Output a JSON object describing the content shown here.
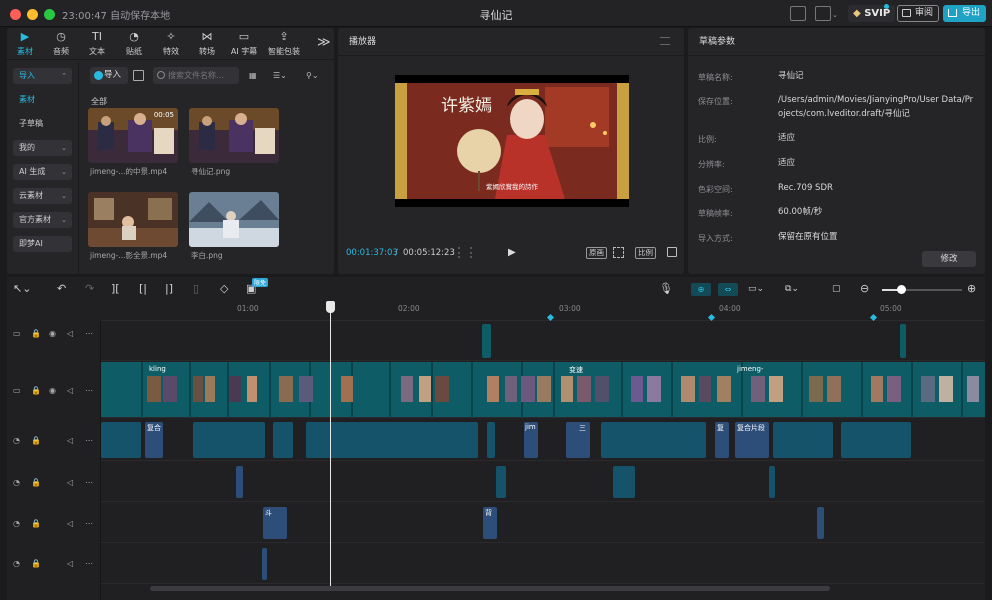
{
  "window": {
    "status": "23:00:47 自动保存本地",
    "title": "寻仙记",
    "svip": "SVIP",
    "review_label": "审阅",
    "export_label": "导出"
  },
  "media": {
    "tabs": [
      {
        "label": "素材",
        "icon": "media-icon",
        "glyph": "▶",
        "active": true
      },
      {
        "label": "音频",
        "icon": "audio-icon",
        "glyph": "◷"
      },
      {
        "label": "文本",
        "icon": "text-icon",
        "glyph": "TI"
      },
      {
        "label": "贴纸",
        "icon": "sticker-icon",
        "glyph": "◔"
      },
      {
        "label": "特效",
        "icon": "effects-icon",
        "glyph": "✧"
      },
      {
        "label": "转场",
        "icon": "transition-icon",
        "glyph": "⋈"
      },
      {
        "label": "AI 字幕",
        "icon": "ai-caption-icon",
        "glyph": "▭"
      },
      {
        "label": "智能包装",
        "icon": "smart-pack-icon",
        "glyph": "⇪"
      }
    ],
    "more_tabs": "≫",
    "nav": [
      {
        "label": "导入",
        "active": true,
        "boxed": true,
        "chev": "⌃"
      },
      {
        "label": "素材",
        "active": true
      },
      {
        "label": "子草稿"
      },
      {
        "label": "我的",
        "boxed": true,
        "chev": "⌄"
      },
      {
        "label": "AI 生成",
        "boxed": true,
        "chev": "⌄"
      },
      {
        "label": "云素材",
        "boxed": true,
        "chev": "⌄"
      },
      {
        "label": "官方素材",
        "boxed": true,
        "chev": "⌄"
      },
      {
        "label": "即梦AI",
        "boxed": true
      }
    ],
    "import_label": "导入",
    "search_placeholder": "搜索文件名称...",
    "section_label": "全部",
    "items": [
      {
        "caption": "jimeng-...的中景.mp4",
        "duration": "00:05"
      },
      {
        "caption": "寻仙记.png"
      },
      {
        "caption": "jimeng-...影全景.mp4"
      },
      {
        "caption": "李白.png"
      }
    ]
  },
  "player": {
    "title": "播放器",
    "video_title": "许紫嫣",
    "subtitle": "紫嫣欣賞我的詩作",
    "current_time": "00:01:37:03",
    "separator": "/",
    "total_time": "00:05:12:23",
    "original_label": "原画",
    "ratio_label": "比例"
  },
  "props": {
    "title": "草稿参数",
    "rows": [
      {
        "label": "草稿名称:",
        "value": "寻仙记"
      },
      {
        "label": "保存位置:",
        "value": "/Users/admin/Movies/JianyingPro/User Data/Projects/com.lveditor.draft/寻仙记"
      },
      {
        "label": "比例:",
        "value": "适应"
      },
      {
        "label": "分辨率:",
        "value": "适应"
      },
      {
        "label": "色彩空间:",
        "value": "Rec.709 SDR"
      },
      {
        "label": "草稿帧率:",
        "value": "60.00帧/秒"
      },
      {
        "label": "导入方式:",
        "value": "保留在原有位置"
      }
    ],
    "modify_label": "修改"
  },
  "timeline": {
    "limited_badge": "限免",
    "ruler": [
      "01:00",
      "02:00",
      "03:00",
      "04:00",
      "05:00"
    ],
    "clip_labels": {
      "a1": "复合",
      "a2": "jim",
      "a3": "三",
      "a4": "复",
      "a5": "复合片段",
      "b1": "斗",
      "b2": "背",
      "m1": "kling",
      "m2": "变速",
      "m3": "jimeng-"
    }
  },
  "colors": {
    "accent": "#27bbe0",
    "export": "#1fa3c4",
    "main_track": "#0e5c66",
    "audio_clip": "#2e4e7a"
  }
}
